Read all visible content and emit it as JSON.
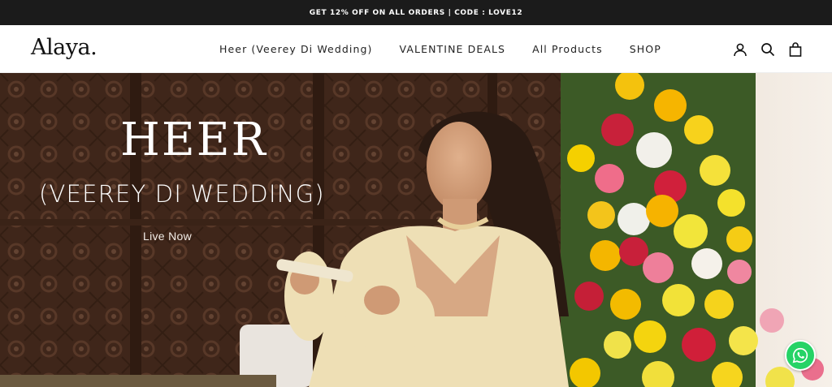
{
  "announcement": {
    "text": "GET 12% OFF ON ALL ORDERS | CODE : LOVE12"
  },
  "header": {
    "logo": "Alaya.",
    "nav": [
      {
        "label": "Heer (Veerey Di Wedding)"
      },
      {
        "label": "VALENTINE DEALS"
      },
      {
        "label": "All Products"
      },
      {
        "label": "SHOP"
      }
    ],
    "icons": [
      "account-icon",
      "search-icon",
      "cart-icon"
    ]
  },
  "hero": {
    "title": "HEER",
    "subtitle": "(VEEREY DI WEDDING)",
    "cta": "Live Now"
  },
  "floating": {
    "icon": "whatsapp-icon",
    "color": "#25d366"
  },
  "colors": {
    "announcement_bg": "#1b1b1b",
    "hero_bg": "#5a3a28"
  }
}
